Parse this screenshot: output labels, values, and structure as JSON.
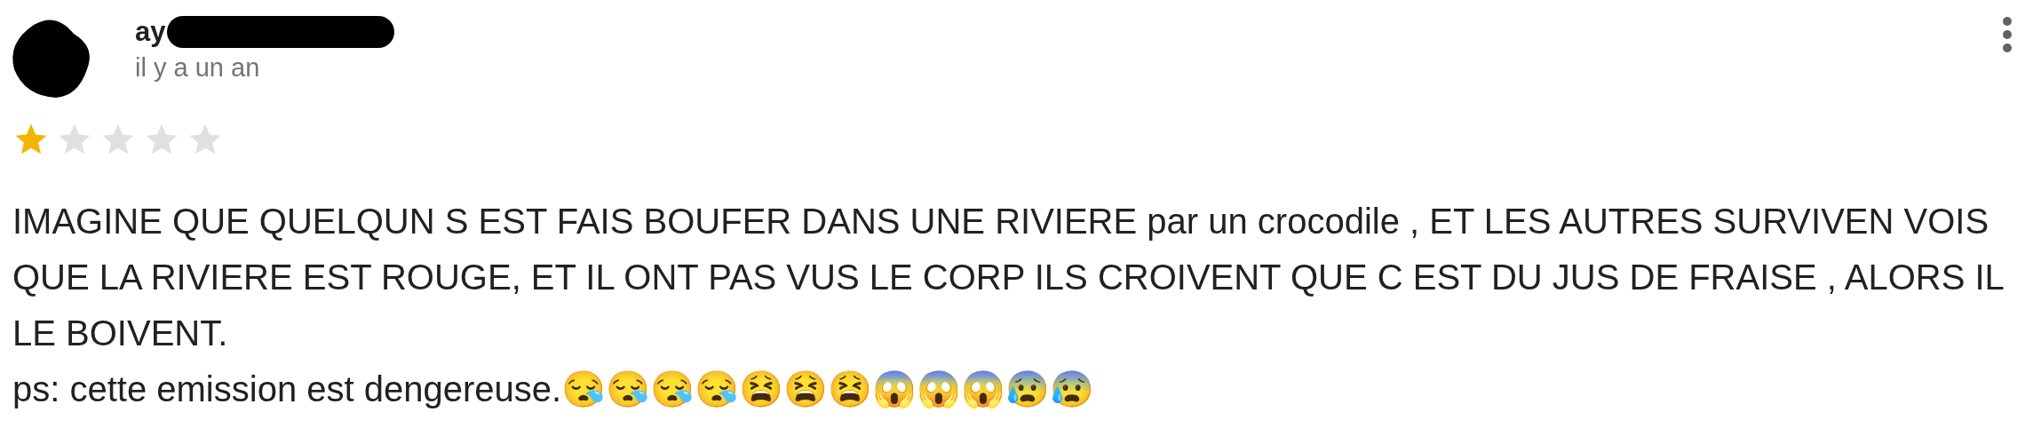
{
  "review": {
    "author": "ay",
    "time": "il y a un an",
    "stars": 1,
    "paragraphs": [
      "IMAGINE QUE QUELQUN S EST FAIS BOUFER DANS UNE RIVIERE par un crocodile , ET LES AUTRES SURVIVEN VOIS QUE LA RIVIERE EST ROUGE, ET IL ONT PAS VUS LE CORP ILS CROIVENT QUE C EST DU JUS DE FRAISE , ALORS IL LE BOIVENT.",
      "ps: cette emission est dengereuse.😪😪😪😪😫😫😫😱😱😱😰😰"
    ]
  }
}
